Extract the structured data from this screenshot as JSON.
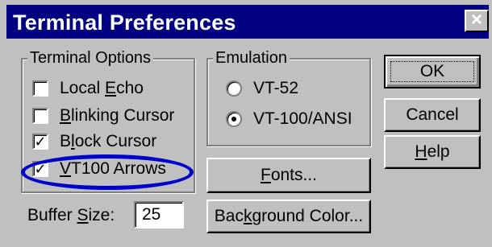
{
  "title": "Terminal Preferences",
  "close_glyph": "×",
  "terminal_options": {
    "label": "Terminal Options",
    "items": [
      {
        "pre": "Local ",
        "acc": "E",
        "post": "cho",
        "checked": false
      },
      {
        "pre": "",
        "acc": "B",
        "post": "linking Cursor",
        "checked": false
      },
      {
        "pre": "B",
        "acc": "l",
        "post": "ock Cursor",
        "checked": true
      },
      {
        "pre": "",
        "acc": "V",
        "post": "T100 Arrows",
        "checked": true
      }
    ]
  },
  "emulation": {
    "label": "Emulation",
    "items": [
      {
        "label": "VT-52",
        "selected": false
      },
      {
        "label": "VT-100/ANSI",
        "selected": true
      }
    ]
  },
  "buttons": {
    "ok": "OK",
    "cancel": "Cancel",
    "help_acc": "H",
    "help_rest": "elp",
    "fonts_acc": "F",
    "fonts_rest": "onts...",
    "bg_pre": "Bac",
    "bg_acc": "k",
    "bg_post": "ground Color..."
  },
  "buffer": {
    "label_pre": "Buffer ",
    "label_acc": "S",
    "label_post": "ize:",
    "value": "25"
  },
  "colors": {
    "titlebar": "#000080",
    "dialog": "#c0c0c0",
    "highlight": "#0000cc"
  },
  "checkmark_glyph": "✓"
}
